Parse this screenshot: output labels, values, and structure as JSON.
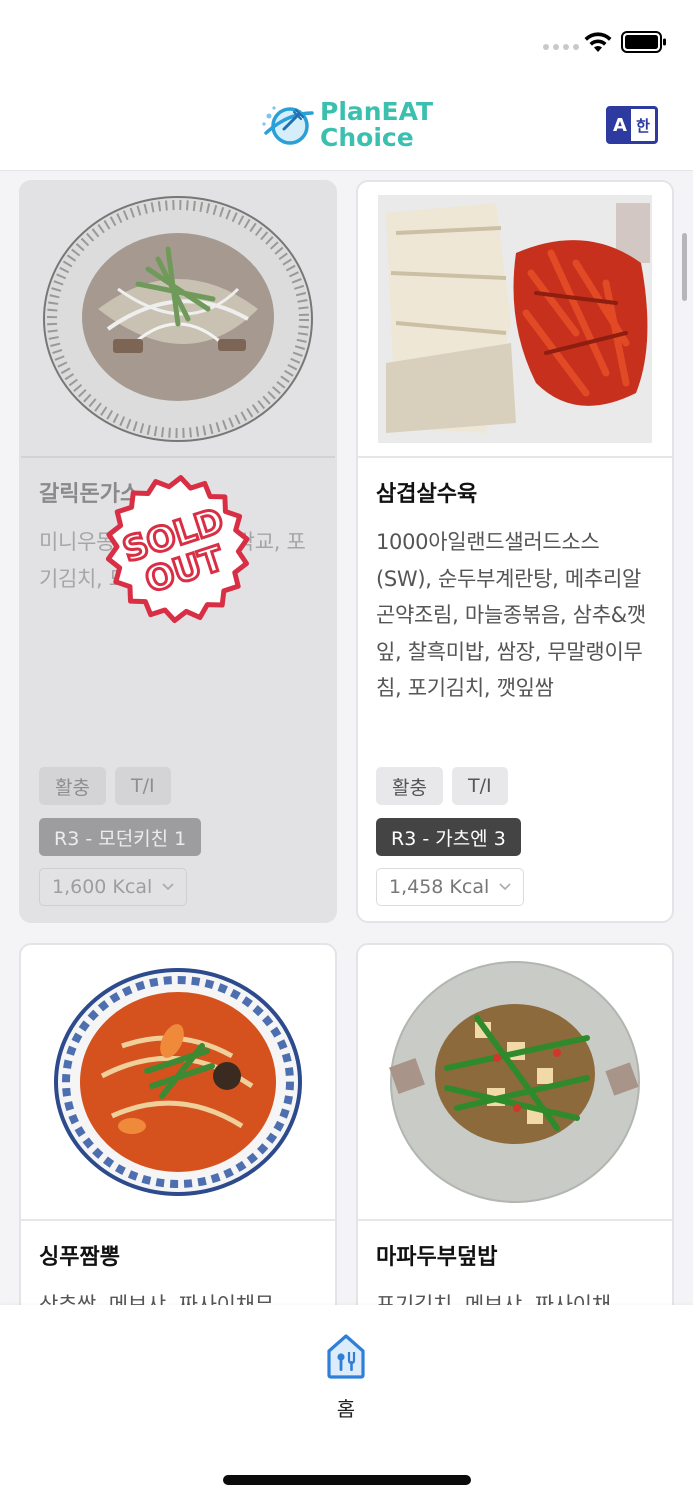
{
  "status_bar": {
    "signal_icon": "signal-dots-icon",
    "wifi_icon": "wifi-icon",
    "battery_icon": "battery-icon"
  },
  "header": {
    "logo_line1": "PlanEAT",
    "logo_line2": "Choice",
    "logo_icon": "planet-fork-logo",
    "lang_toggle_a": "A",
    "lang_toggle_k": "한",
    "accent_color": "#3bbfae",
    "lang_color": "#2d3aa0"
  },
  "menu": [
    {
      "title": "갈릭돈가스",
      "description": "미니우동, 하프샐러드, 락교, 포기김치, 드레싱FS",
      "tags": [
        "활충",
        "T/I"
      ],
      "location": "R3 - 모던키친 1",
      "kcal": "1,600 Kcal",
      "sold_out": true,
      "sold_out_label_1": "SOLD",
      "sold_out_label_2": "OUT"
    },
    {
      "title": "삼겹살수육",
      "description": "1000아일랜드샐러드소스(SW), 순두부계란탕, 메추리알곤약조림, 마늘종볶음, 삼추&깻잎, 찰흑미밥, 쌈장, 무말랭이무침, 포기김치, 깻잎쌈",
      "tags": [
        "활충",
        "T/I"
      ],
      "location": "R3 - 가츠엔 3",
      "kcal": "1,458 Kcal",
      "sold_out": false
    },
    {
      "title": "싱푸짬뽕",
      "description": "상추쌈, 메보샤, 짜사이채무",
      "sold_out": false
    },
    {
      "title": "마파두부덮밥",
      "description": "포기김치, 메보샤, 짜사이채",
      "sold_out": false
    }
  ],
  "tabbar": {
    "home_label": "홈",
    "home_icon": "home-utensils-icon",
    "active_color": "#2f7fd8"
  }
}
